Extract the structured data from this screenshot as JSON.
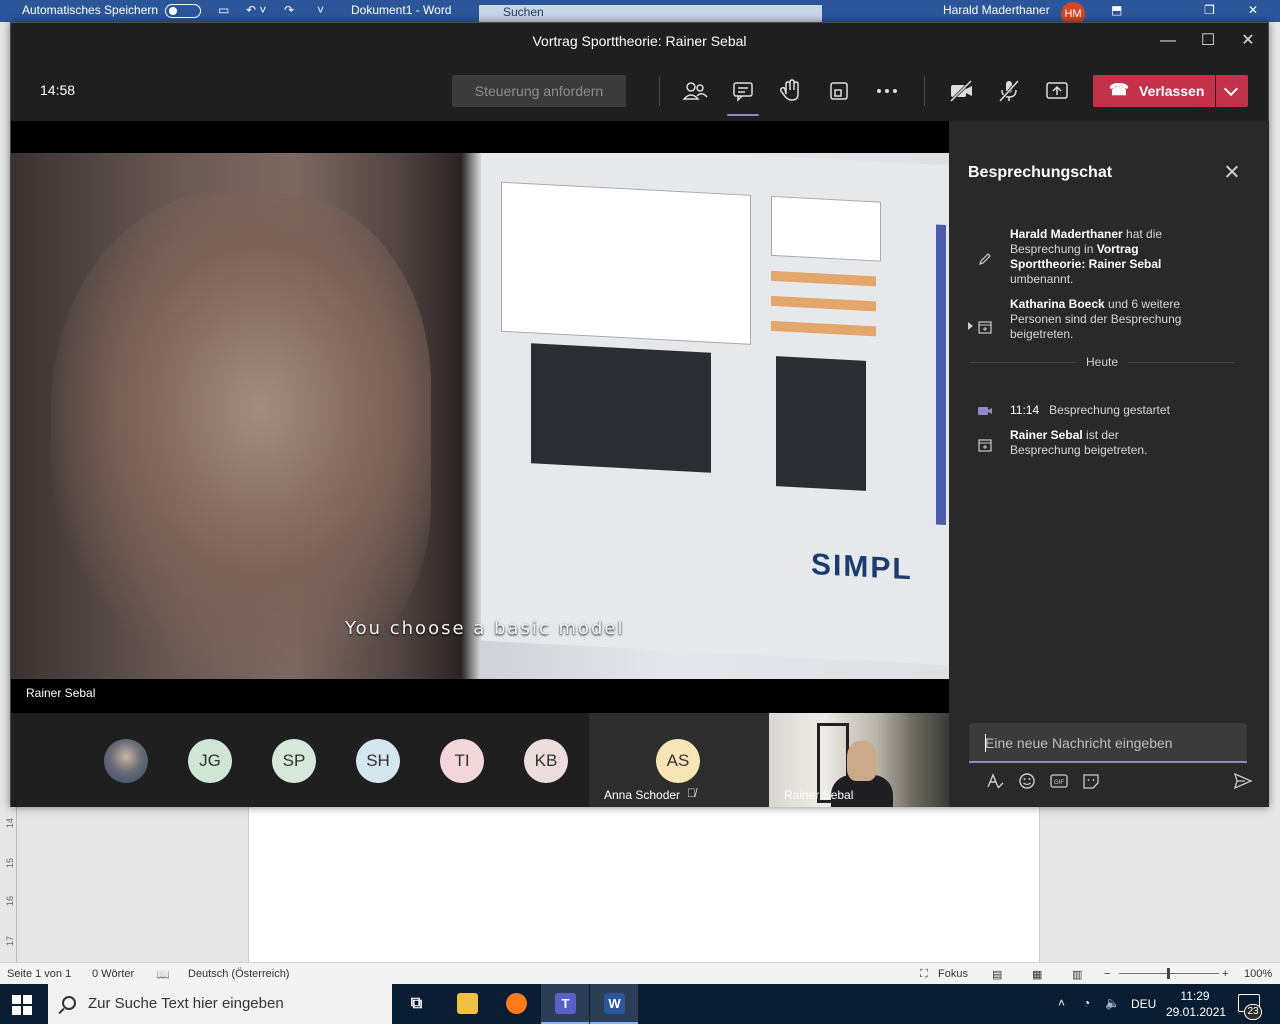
{
  "word": {
    "autosave_label": "Automatisches Speichern",
    "doc_title": "Dokument1 - Word",
    "search_placeholder": "Suchen",
    "user_name": "Harald Maderthaner",
    "user_initials": "HM",
    "ruler_marks": [
      "14",
      "15",
      "16",
      "17"
    ],
    "status": {
      "page": "Seite 1 von 1",
      "words": "0 Wörter",
      "language": "Deutsch (Österreich)",
      "focus": "Fokus",
      "zoom": "100%"
    }
  },
  "teams": {
    "window_title": "Vortrag Sporttheorie: Rainer Sebal",
    "time": "14:58",
    "request_control_label": "Steuerung anfordern",
    "leave_label": "Verlassen",
    "active_tool": "chat",
    "video": {
      "caption": "You choose a basic model",
      "speaker": "Rainer Sebal",
      "screen_logo": "SIMPL"
    },
    "participants": [
      {
        "initials": "",
        "photo": true,
        "bg": "#6a6c75"
      },
      {
        "initials": "JG",
        "bg": "#cfe6d5"
      },
      {
        "initials": "SP",
        "bg": "#d6e8da"
      },
      {
        "initials": "SH",
        "bg": "#d4e6ef"
      },
      {
        "initials": "TI",
        "bg": "#f2d6da"
      },
      {
        "initials": "KB",
        "bg": "#eedddd"
      }
    ],
    "tile_anna": {
      "initials": "AS",
      "name": "Anna Schoder",
      "bg": "#f7e5b5"
    },
    "tile_rainer": {
      "name": "Rainer Sebal"
    },
    "chat": {
      "title": "Besprechungschat",
      "m1": {
        "actor": "Harald Maderthaner",
        "text1": " hat die Besprechung in ",
        "meeting": "Vortrag Sporttheorie: Rainer Sebal",
        "text2": " umbenannt."
      },
      "m2": {
        "actor": "Katharina Boeck",
        "text": " und 6 weitere Personen sind der Besprechung beigetreten."
      },
      "divider": "Heute",
      "m3": {
        "time": "11:14",
        "text": "Besprechung gestartet"
      },
      "m4": {
        "actor": "Rainer Sebal",
        "text": " ist der Besprechung beigetreten."
      },
      "input_placeholder": "Eine neue Nachricht eingeben"
    }
  },
  "taskbar": {
    "search_placeholder": "Zur Suche Text hier eingeben",
    "language": "DEU",
    "time": "11:29",
    "date": "29.01.2021",
    "notification_count": "23"
  },
  "colors": {
    "word_blue": "#2b579a",
    "teams_bg": "#1f1f1f",
    "teams_accent": "#8b8cc7",
    "leave_red": "#c4314b"
  }
}
